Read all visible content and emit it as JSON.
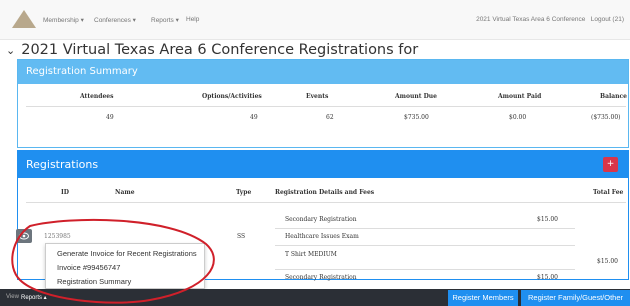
{
  "nav": {
    "items": [
      "Membership ▾",
      "Conferences ▾",
      "Reports ▾",
      "Help"
    ],
    "conference": "2021 Virtual Texas Area 6 Conference",
    "logout": "Logout (21)"
  },
  "page": {
    "chevron": "⌄",
    "title": "2021 Virtual Texas Area 6 Conference Registrations for"
  },
  "summary": {
    "title": "Registration Summary",
    "headers": [
      "Attendees",
      "Options/Activities",
      "Events",
      "Amount Due",
      "Amount Paid",
      "Balance"
    ],
    "values": [
      "49",
      "49",
      "62",
      "$735.00",
      "$0.00",
      "($735.00)"
    ]
  },
  "registrations": {
    "title": "Registrations",
    "plus": "+",
    "headers": [
      "ID",
      "Name",
      "Type",
      "Registration Details and Fees",
      "Total Fee"
    ],
    "row": {
      "id": "1253985",
      "type": "SS",
      "details": [
        "Secondary Registration",
        "Healthcare Issues Exam",
        "T Shirt MEDIUM",
        "Secondary Registration"
      ],
      "fees": [
        "$15.00",
        "$15.00"
      ],
      "total": "$15.00"
    }
  },
  "dropdown": {
    "items": [
      "Generate Invoice for Recent Registrations",
      "Invoice #99456747",
      "Registration Summary"
    ]
  },
  "bottom": {
    "view": "View",
    "reports": "Reports ▴",
    "register_members": "Register Members",
    "register_other": "Register Family/Guest/Other"
  },
  "colors": {
    "accent": "#1f8ff0",
    "summary_header": "#62bbf2",
    "danger": "#d9354a",
    "annotation": "#d0202a"
  },
  "icons": {
    "view_button": "eye-icon"
  }
}
